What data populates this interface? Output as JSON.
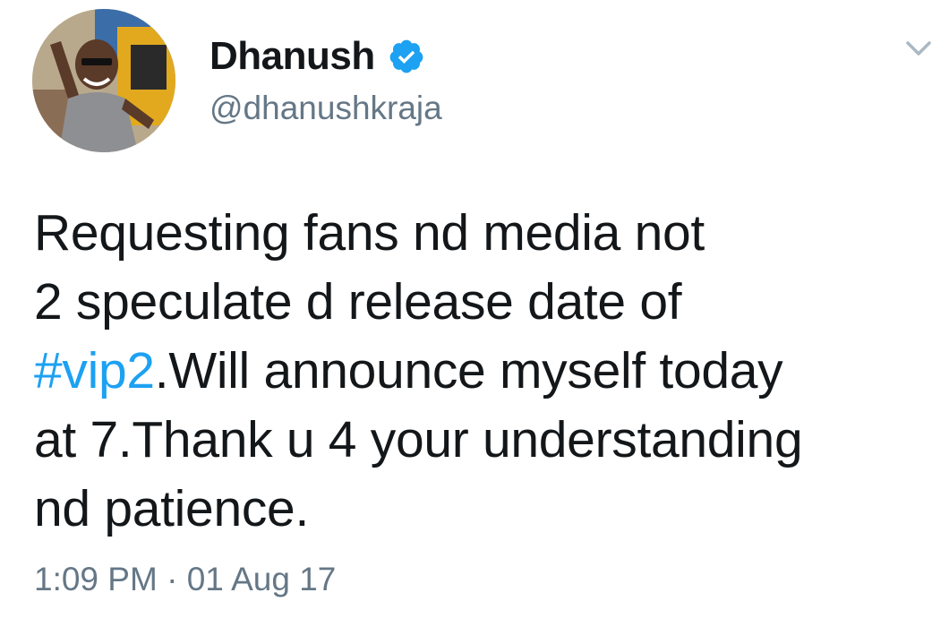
{
  "author": {
    "display_name": "Dhanush",
    "handle": "@dhanushkraja",
    "verified": true,
    "avatar_icon": "profile-photo"
  },
  "tweet": {
    "line1": "Requesting fans nd media not",
    "line2": "2 speculate d release date of",
    "hashtag": "#vip2",
    "line3_rest": ".Will announce myself today",
    "line4": "at 7.Thank u 4 your understanding",
    "line5": "nd patience.",
    "time": "1:09 PM",
    "separator": "·",
    "date": "01 Aug 17"
  },
  "colors": {
    "text": "#14171a",
    "secondary": "#657786",
    "accent": "#1da1f2",
    "verified_badge": "#1da1f2"
  },
  "icons": {
    "verified": "verified-badge-icon",
    "menu": "chevron-down-icon"
  }
}
